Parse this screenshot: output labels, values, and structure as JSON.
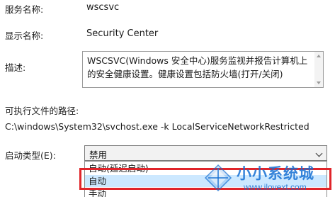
{
  "service_name": {
    "label": "服务名称:",
    "value": "wscsvc"
  },
  "display_name": {
    "label": "显示名称:",
    "value": "Security Center"
  },
  "description": {
    "label": "描述:",
    "text": "WSCSVC(Windows 安全中心)服务监视并报告计算机上的安全健康设置。健康设置包括防火墙(打开/关闭)"
  },
  "executable_path": {
    "label": "可执行文件的路径:",
    "value": "C:\\windows\\System32\\svchost.exe -k LocalServiceNetworkRestricted"
  },
  "startup_type": {
    "label": "启动类型(E):",
    "selected": "禁用",
    "options": [
      "自动(延迟启动)",
      "自动",
      "手动"
    ],
    "highlighted_option": "自动"
  },
  "watermark": {
    "title": "小小系统城",
    "url": "www.ilovext.com"
  },
  "colors": {
    "highlight_border": "#e0242a",
    "selected_option_bg": "#cce8ff",
    "watermark": "#146ed2"
  }
}
